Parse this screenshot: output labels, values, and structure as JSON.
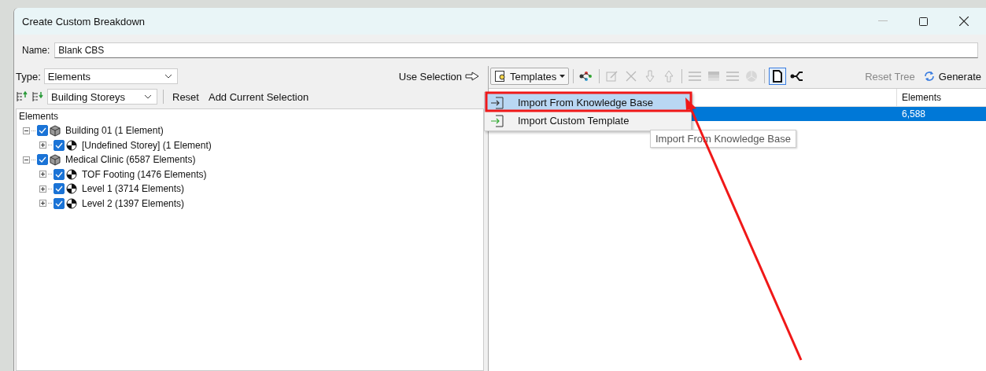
{
  "window": {
    "title": "Create Custom Breakdown"
  },
  "name_field": {
    "label": "Name:",
    "value": "Blank CBS"
  },
  "type_field": {
    "label": "Type:",
    "value": "Elements"
  },
  "use_selection": "Use Selection",
  "grouping": {
    "value": "Building Storeys",
    "reset": "Reset",
    "add_current_selection": "Add Current Selection"
  },
  "tree": {
    "header": "Elements",
    "items": [
      {
        "label": "Building 01 (1 Element)",
        "kind": "building",
        "checked": true,
        "expanded": true,
        "children": [
          {
            "label": "[Undefined Storey] (1 Element)",
            "kind": "storey",
            "checked": true,
            "expanded": false
          }
        ]
      },
      {
        "label": "Medical Clinic (6587 Elements)",
        "kind": "building",
        "checked": true,
        "expanded": true,
        "children": [
          {
            "label": "TOF Footing (1476 Elements)",
            "kind": "storey",
            "checked": true,
            "expanded": false
          },
          {
            "label": "Level 1 (3714 Elements)",
            "kind": "storey",
            "checked": true,
            "expanded": false
          },
          {
            "label": "Level 2 (1397 Elements)",
            "kind": "storey",
            "checked": true,
            "expanded": false
          }
        ]
      }
    ]
  },
  "templates_button": "Templates",
  "tools": [
    {
      "kind": "cluster",
      "disabled": false,
      "pressed": false
    },
    {
      "kind": "edit",
      "disabled": true,
      "pressed": false
    },
    {
      "kind": "delete",
      "disabled": true,
      "pressed": false
    },
    {
      "kind": "down",
      "disabled": true,
      "pressed": false
    },
    {
      "kind": "up",
      "disabled": true,
      "pressed": false
    },
    {
      "kind": "lines",
      "disabled": true,
      "pressed": false
    },
    {
      "kind": "gradient",
      "disabled": true,
      "pressed": false
    },
    {
      "kind": "lines",
      "disabled": true,
      "pressed": false
    },
    {
      "kind": "sphere",
      "disabled": true,
      "pressed": false
    },
    {
      "kind": "page",
      "disabled": false,
      "pressed": true
    },
    {
      "kind": "branch",
      "disabled": false,
      "pressed": false
    }
  ],
  "reset_tree": {
    "label": "Reset Tree",
    "disabled": true
  },
  "generate": "Generate",
  "table": {
    "columns": [
      "Elements"
    ],
    "rows": [
      {
        "elements": "6,588",
        "selected": true
      }
    ]
  },
  "menu": {
    "items": [
      {
        "label": "Import From Knowledge Base",
        "selected": true
      },
      {
        "label": "Import Custom Template",
        "selected": false
      }
    ]
  },
  "tooltip": "Import From Knowledge Base"
}
